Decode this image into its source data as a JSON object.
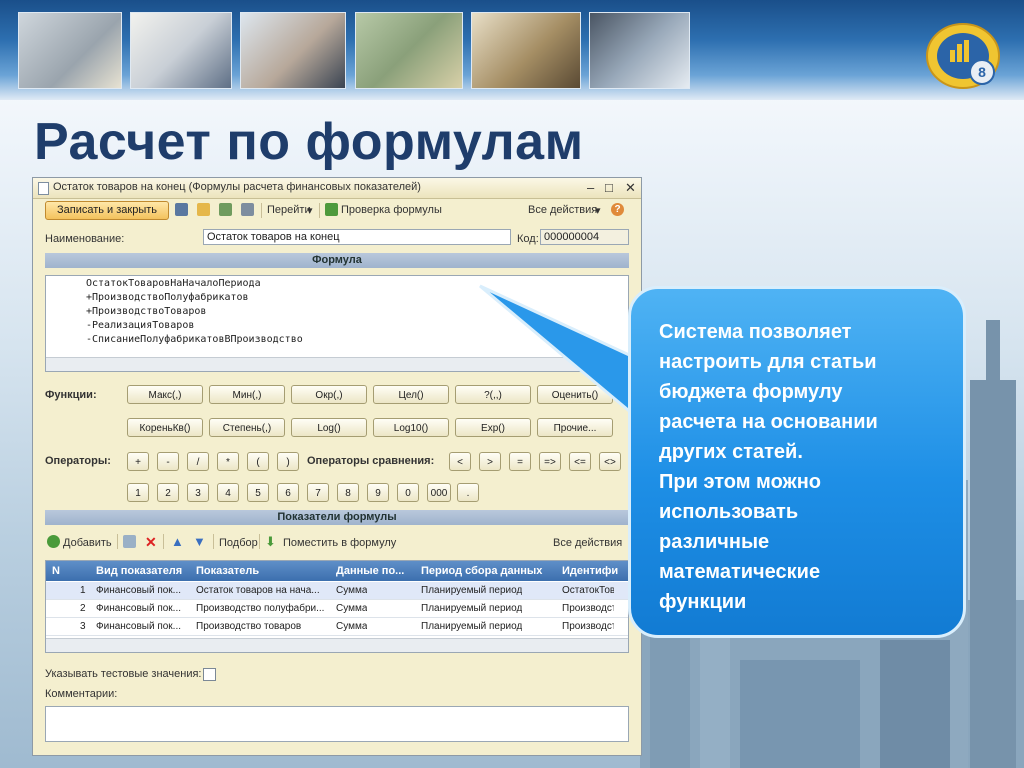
{
  "slide": {
    "title": "Расчет по формулам"
  },
  "colors": {
    "title": "#1f3d6b",
    "callout": "#1e8fe6",
    "grid_header": "#3c6fae",
    "section_header": "#9fb3cd",
    "save_button": "#f3c25d"
  },
  "window": {
    "title": "Остаток товаров на конец (Формулы расчета финансовых показателей)",
    "controls": [
      "–",
      "□",
      "✕"
    ],
    "toolbar": {
      "save_close": "Записать и закрыть",
      "goto": "Перейти",
      "check_formula": "Проверка формулы",
      "all_actions": "Все действия",
      "help": "?"
    },
    "name_label": "Наименование:",
    "name_value": "Остаток товаров на конец",
    "code_label": "Код:",
    "code_value": "000000004",
    "formula_header": "Формула",
    "formula_lines": [
      "ОстатокТоваровНаНачалоПериода",
      "+ПроизводствоПолуфабрикатов",
      "+ПроизводствоТоваров",
      "-РеализацияТоваров",
      "-СписаниеПолуфабрикатовВПроизводство"
    ],
    "functions_label": "Функции:",
    "functions_row1": [
      "Макс(,)",
      "Мин(,)",
      "Окр(,)",
      "Цел()",
      "?(,,)",
      "Оценить()"
    ],
    "functions_row2": [
      "КореньКв()",
      "Степень(,)",
      "Log()",
      "Log10()",
      "Exp()",
      "Прочие..."
    ],
    "operators_label": "Операторы:",
    "operators": [
      "+",
      "-",
      "/",
      "*",
      "(",
      ")"
    ],
    "comparison_label": "Операторы сравнения:",
    "comparison": [
      "<",
      ">",
      "=",
      "=>",
      "<=",
      "<>"
    ],
    "digits": [
      "1",
      "2",
      "3",
      "4",
      "5",
      "6",
      "7",
      "8",
      "9",
      "0",
      "000",
      "."
    ],
    "indicators_header": "Показатели формулы",
    "indicators_toolbar": {
      "add": "Добавить",
      "select": "Подбор",
      "put_into_formula": "Поместить в формулу",
      "all_actions": "Все действия"
    },
    "grid": {
      "columns": [
        "N",
        "Вид показателя",
        "Показатель",
        "Данные по...",
        "Период сбора данных",
        "Идентифи"
      ],
      "rows": [
        [
          "1",
          "Финансовый пок...",
          "Остаток товаров на нача...",
          "Сумма",
          "Планируемый период",
          "ОстатокТов"
        ],
        [
          "2",
          "Финансовый пок...",
          "Производство полуфабри...",
          "Сумма",
          "Планируемый период",
          "Производст"
        ],
        [
          "3",
          "Финансовый пок...",
          "Производство товаров",
          "Сумма",
          "Планируемый период",
          "Производст"
        ]
      ]
    },
    "test_values_label": "Указывать тестовые значения:",
    "comments_label": "Комментарии:"
  },
  "callout": {
    "lines": [
      "Система позволяет",
      "настроить для статьи",
      "бюджета формулу",
      "расчета на основании",
      "других статей.",
      "При этом можно",
      "использовать",
      "различные",
      "математические",
      "функции"
    ]
  }
}
